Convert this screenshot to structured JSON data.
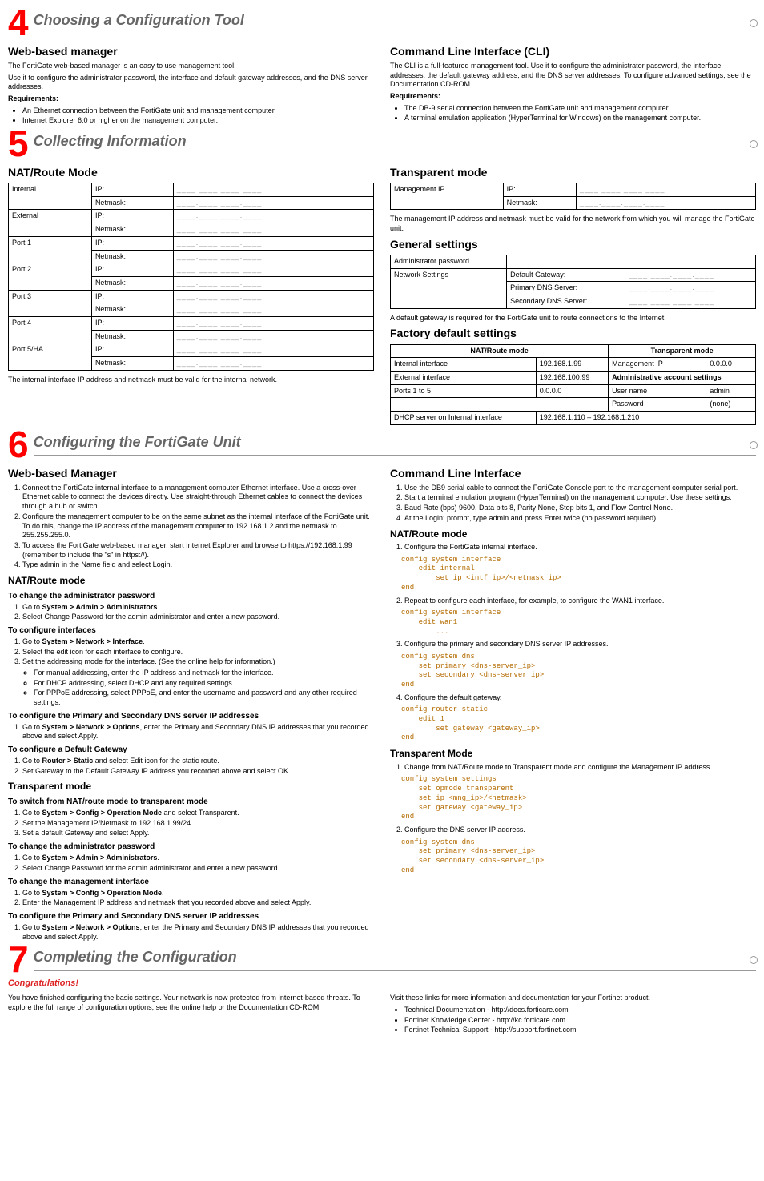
{
  "sections": {
    "s4": {
      "num": "4",
      "title": "Choosing a Configuration Tool"
    },
    "s5": {
      "num": "5",
      "title": "Collecting Information"
    },
    "s6": {
      "num": "6",
      "title": "Configuring the FortiGate Unit"
    },
    "s7": {
      "num": "7",
      "title": "Completing the Configuration"
    }
  },
  "s4": {
    "left": {
      "h": "Web-based manager",
      "p1": "The FortiGate web-based manager is an easy to use management tool.",
      "p2": "Use it to configure the administrator password, the interface and default gateway addresses, and the DNS server addresses.",
      "reqH": "Requirements:",
      "reqs": [
        "An Ethernet connection between the FortiGate unit and management computer.",
        "Internet Explorer 6.0 or higher on the management computer."
      ]
    },
    "right": {
      "h": "Command Line Interface (CLI)",
      "p1": "The CLI is a full-featured management tool. Use it to configure the administrator password, the interface addresses, the default gateway address, and the DNS server addresses. To configure advanced settings, see the Documentation CD-ROM.",
      "reqH": "Requirements:",
      "reqs": [
        "The DB-9 serial connection between the FortiGate unit and management computer.",
        "A terminal emulation application (HyperTerminal for Windows) on the management computer."
      ]
    }
  },
  "s5": {
    "left": {
      "h": "NAT/Route Mode",
      "rows": [
        {
          "name": "Internal",
          "ip": "IP:",
          "nm": "Netmask:"
        },
        {
          "name": "External",
          "ip": "IP:",
          "nm": "Netmask:"
        },
        {
          "name": "Port 1",
          "ip": "IP:",
          "nm": "Netmask:"
        },
        {
          "name": "Port 2",
          "ip": "IP:",
          "nm": "Netmask:"
        },
        {
          "name": "Port 3",
          "ip": "IP:",
          "nm": "Netmask:"
        },
        {
          "name": "Port 4",
          "ip": "IP:",
          "nm": "Netmask:"
        },
        {
          "name": "Port 5/HA",
          "ip": "IP:",
          "nm": "Netmask:"
        }
      ],
      "note": "The internal interface IP address and netmask must be valid for the internal network.",
      "blank": "____.____.____.____"
    },
    "right": {
      "trH": "Transparent mode",
      "trRow": {
        "name": "Management IP",
        "ip": "IP:",
        "nm": "Netmask:"
      },
      "trNote": "The management IP address and netmask must be valid for the network from which you will manage the FortiGate unit.",
      "genH": "General settings",
      "gen": {
        "adminPw": "Administrator password",
        "netSet": "Network Settings",
        "defGw": "Default Gateway:",
        "pDns": "Primary DNS Server:",
        "sDns": "Secondary DNS Server:"
      },
      "genNote": "A default gateway is required for the FortiGate unit to route connections to the Internet.",
      "facH": "Factory default settings",
      "fac": {
        "natH": "NAT/Route mode",
        "trH": "Transparent mode",
        "r1": {
          "a": "Internal interface",
          "b": "192.168.1.99",
          "c": "Management IP",
          "d": "0.0.0.0"
        },
        "r2": {
          "a": "External interface",
          "b": "192.168.100.99",
          "c": "Administrative account settings"
        },
        "r3": {
          "a": "Ports 1 to 5",
          "b": "0.0.0.0",
          "c": "User name",
          "d": "admin"
        },
        "r4": {
          "c": "Password",
          "d": "(none)"
        },
        "r5": {
          "a": "DHCP server on Internal interface",
          "b": "192.168.1.110 – 192.168.1.210"
        }
      }
    }
  },
  "s6": {
    "left": {
      "h": "Web-based Manager",
      "intro": [
        "Connect the FortiGate internal interface to a management computer Ethernet interface. Use a cross-over Ethernet cable to connect the devices directly. Use straight-through Ethernet cables to connect the devices through a hub or switch.",
        "Configure the management computer to be on the same subnet as the internal interface of the FortiGate unit. To do this, change the IP address of the management computer to 192.168.1.2 and the netmask to 255.255.255.0.",
        "To access the FortiGate web-based manager, start Internet Explorer and browse to https://192.168.1.99 (remember to include the \"s\" in https://).",
        "Type admin in the Name field and select Login."
      ],
      "natH": "NAT/Route mode",
      "chPw": "To change the administrator password",
      "chPw1": "Go to ",
      "chPw1b": "System > Admin > Administrators",
      "chPw1c": ".",
      "chPw2": "Select Change Password for the admin administrator and enter a new password.",
      "ciH": "To configure interfaces",
      "ci1a": "Go to ",
      "ci1b": "System > Network > Interface",
      "ci1c": ".",
      "ci2": "Select the edit icon for each interface to configure.",
      "ci3": "Set the addressing mode for the interface. (See the online help for information.)",
      "ci3sub": [
        "For manual addressing, enter the IP address and netmask for the interface.",
        "For DHCP addressing, select DHCP and any required settings.",
        "For PPPoE addressing, select PPPoE, and enter the username and password and any other required settings."
      ],
      "dnsH": "To configure the Primary and Secondary DNS server IP addresses",
      "dns1a": "Go to ",
      "dns1b": "System > Network > Options",
      "dns1c": ", enter the Primary and Secondary DNS IP addresses that you recorded above and select Apply.",
      "gwH": "To configure a Default Gateway",
      "gw1a": "Go to ",
      "gw1b": "Router > Static",
      "gw1c": " and select Edit icon for the static route.",
      "gw2": "Set Gateway to the Default Gateway IP address you recorded above and select OK.",
      "trH": "Transparent mode",
      "swH": "To switch from NAT/route mode to transparent mode",
      "sw1a": "Go to ",
      "sw1b": "System > Config > Operation Mode",
      "sw1c": " and select Transparent.",
      "sw2": "Set the Management IP/Netmask to 192.168.1.99/24.",
      "sw3": "Set a default Gateway and select Apply.",
      "chPw2H": "To change the administrator password",
      "chPw2_1a": "Go to ",
      "chPw2_1b": "System > Admin > Administrators",
      "chPw2_1c": ".",
      "chPw2_2": "Select Change Password for the admin administrator and enter a new password.",
      "miH": "To change the management interface",
      "mi1a": "Go to ",
      "mi1b": "System > Config > Operation Mode",
      "mi1c": ".",
      "mi2": "Enter the Management IP address and netmask that you recorded above and select Apply.",
      "dns2H": "To configure the Primary and Secondary DNS server IP addresses",
      "dns2_1a": "Go to ",
      "dns2_1b": "System > Network > Options",
      "dns2_1c": ", enter the Primary and Secondary DNS IP addresses that you recorded above and select Apply."
    },
    "right": {
      "h": "Command Line Interface",
      "intro": [
        "Use the DB9 serial cable to connect the FortiGate Console port to the management computer serial port.",
        "Start a terminal emulation program (HyperTerminal) on the management computer. Use these settings:",
        "Baud Rate (bps) 9600, Data bits 8, Parity None, Stop bits 1, and Flow Control None.",
        "At the Login: prompt, type admin and press Enter twice (no password required)."
      ],
      "natH": "NAT/Route mode",
      "step1": "Configure the FortiGate internal interface.",
      "code1": "config system interface\n    edit internal\n        set ip <intf_ip>/<netmask_ip>\nend",
      "step2": "Repeat to configure each interface, for example, to configure the WAN1 interface.",
      "code2": "config system interface\n    edit wan1\n        ...",
      "step3": "Configure the primary and secondary DNS server IP addresses.",
      "code3": "config system dns\n    set primary <dns-server_ip>\n    set secondary <dns-server_ip>\nend",
      "step4": "Configure the default gateway.",
      "code4": "config router static\n    edit 1\n        set gateway <gateway_ip>\nend",
      "trH": "Transparent Mode",
      "tstep1": "Change from NAT/Route mode to Transparent mode and configure the Management IP address.",
      "tcode1": "config system settings\n    set opmode transparent\n    set ip <mng_ip>/<netmask>\n    set gateway <gateway_ip>\nend",
      "tstep2": "Configure the DNS server IP address.",
      "tcode2": "config system dns\n    set primary <dns-server_ip>\n    set secondary <dns-server_ip>\nend"
    }
  },
  "s7": {
    "congrats": "Congratulations!",
    "left": "You have finished configuring the basic settings. Your network is now protected from Internet-based threats. To explore the full range of configuration options, see the online help or the Documentation CD-ROM.",
    "rightIntro": "Visit these links for more information and documentation for your Fortinet product.",
    "links": [
      "Technical Documentation - http://docs.forticare.com",
      "Fortinet Knowledge Center - http://kc.forticare.com",
      "Fortinet Technical Support - http://support.fortinet.com"
    ]
  }
}
